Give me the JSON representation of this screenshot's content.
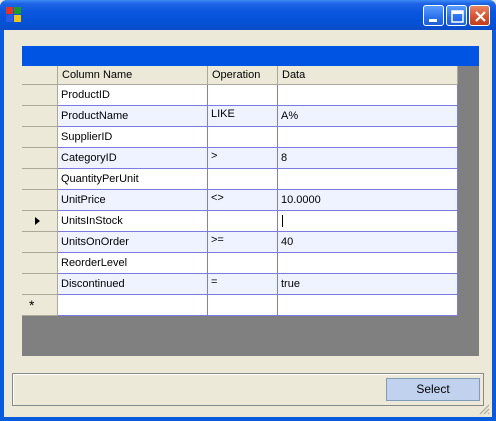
{
  "window": {
    "title": ""
  },
  "grid": {
    "columns": [
      "Column Name",
      "Operation",
      "Data"
    ],
    "rows": [
      {
        "column": "ProductID",
        "operation": "",
        "data": ""
      },
      {
        "column": "ProductName",
        "operation": "LIKE",
        "data": "A%"
      },
      {
        "column": "SupplierID",
        "operation": "",
        "data": ""
      },
      {
        "column": "CategoryID",
        "operation": ">",
        "data": "8"
      },
      {
        "column": "QuantityPerUnit",
        "operation": "",
        "data": ""
      },
      {
        "column": "UnitPrice",
        "operation": "<>",
        "data": "10.0000"
      },
      {
        "column": "UnitsInStock",
        "operation": "",
        "data": ""
      },
      {
        "column": "UnitsOnOrder",
        "operation": ">=",
        "data": "40"
      },
      {
        "column": "ReorderLevel",
        "operation": "",
        "data": ""
      },
      {
        "column": "Discontinued",
        "operation": "=",
        "data": "true"
      }
    ],
    "current_row_indicator": "arrow",
    "new_row_indicator": "*"
  },
  "actions": {
    "select_label": "Select"
  },
  "colors": {
    "titlebar": "#0a56de",
    "caption": "#0054e3",
    "grid_lines": "#7b7be0",
    "select_button": "#c1d2ee"
  }
}
